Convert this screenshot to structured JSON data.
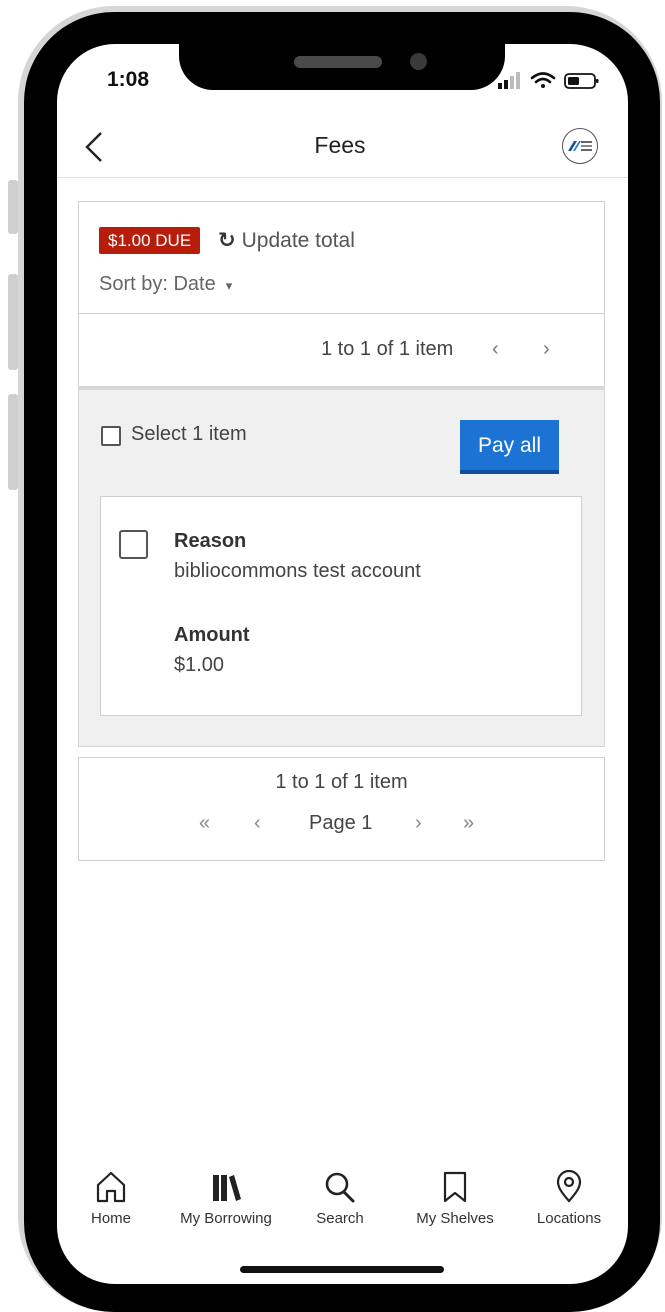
{
  "status_bar": {
    "time": "1:08"
  },
  "nav": {
    "title": "Fees"
  },
  "summary": {
    "due_badge": "$1.00 DUE",
    "update_total": "Update total",
    "sort_by": "Sort by: Date"
  },
  "top_pagination": {
    "text": "1 to 1 of 1 item",
    "prev": "‹",
    "next": "›"
  },
  "selection": {
    "select_label": "Select 1 item",
    "pay_all": "Pay all"
  },
  "fee_item": {
    "reason_label": "Reason",
    "reason_value": "bibliocommons test account",
    "amount_label": "Amount",
    "amount_value": "$1.00"
  },
  "bottom_pagination": {
    "text": "1 to 1 of 1 item",
    "first": "«",
    "prev": "‹",
    "page": "Page 1",
    "next": "›",
    "last": "»"
  },
  "tab_bar": {
    "items": [
      {
        "label": "Home",
        "icon": "home-icon"
      },
      {
        "label": "My Borrowing",
        "icon": "books-icon"
      },
      {
        "label": "Search",
        "icon": "search-icon"
      },
      {
        "label": "My Shelves",
        "icon": "bookmark-icon"
      },
      {
        "label": "Locations",
        "icon": "location-pin-icon"
      }
    ]
  },
  "colors": {
    "due_badge": "#b81d0c",
    "primary_button": "#1d73d4",
    "panel_gray": "#f0f0f0"
  }
}
